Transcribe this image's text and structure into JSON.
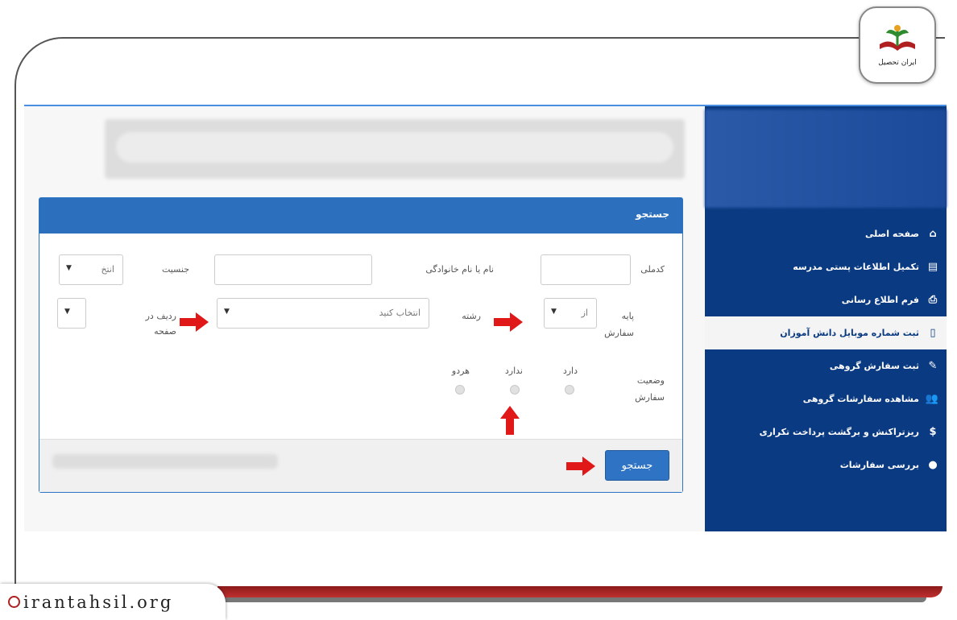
{
  "logo": {
    "text": "ایران تحصیل"
  },
  "badge": {
    "url": "irantahsil.org"
  },
  "sidebar": {
    "items": [
      {
        "label": "صفحه اصلی",
        "icon": "home-icon"
      },
      {
        "label": "تکمیل اطلاعات پستی مدرسه",
        "icon": "card-icon"
      },
      {
        "label": "فرم اطلاع رسانی",
        "icon": "print-icon"
      },
      {
        "label": "ثبت شماره موبایل دانش آموزان",
        "icon": "mobile-icon"
      },
      {
        "label": "ثبت سفارش گروهی",
        "icon": "edit-icon"
      },
      {
        "label": "مشاهده سفارشات گروهی",
        "icon": "users-icon"
      },
      {
        "label": "ریزتراکنش و برگشت پرداخت تکراری",
        "icon": "dollar-icon"
      },
      {
        "label": "بررسی سفارشات",
        "icon": "user-icon"
      }
    ]
  },
  "panel": {
    "title": "جستجو",
    "labels": {
      "national_code": "کدملی",
      "name": "نام یا نام خانوادگی",
      "gender": "جنسیت",
      "grade_line1": "پایه",
      "grade_line2": "سفارش",
      "major": "رشته",
      "rows_line1": "ردیف در",
      "rows_line2": "صفحه",
      "status_line1": "وضعیت",
      "status_line2": "سفارش",
      "has": "دارد",
      "has_not": "ندارد",
      "both": "هردو"
    },
    "selects": {
      "gender": "انتخ",
      "grade": "از",
      "major": "انتخاب کنید"
    },
    "search_button": "جستجو"
  },
  "colors": {
    "sidebar": "#0a3a82",
    "panel_header": "#2b6fbd",
    "arrow": "#e01818"
  }
}
